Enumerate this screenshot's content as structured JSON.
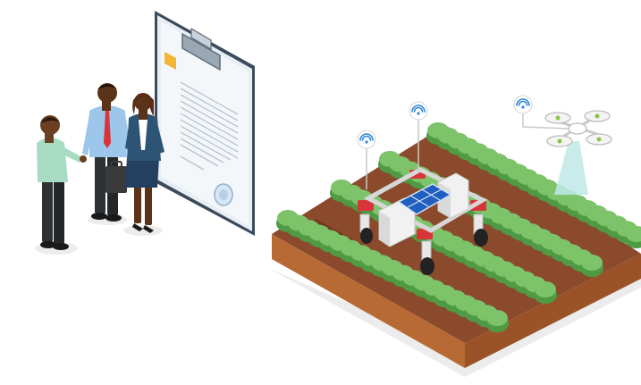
{
  "scene": {
    "people_count": 3,
    "crop_rows": 4,
    "wifi_signals": 3,
    "colors": {
      "background": "#ffffff",
      "paper": "#eef3f7",
      "clipboard": "#3b4a5c",
      "folder_tab": "#f2b632",
      "foliage": "#7cc36a",
      "foliage_dark": "#4f9a44",
      "soil": "#8a4a2b",
      "soil_side": "#b86a35",
      "robot_body": "#f1f1f1",
      "robot_red": "#d8343a",
      "solar_panel": "#1f5fbf",
      "signal_blue": "#2f86d6",
      "drone_beam": "#bfe9e6"
    },
    "icons": {
      "contract": "contract-icon",
      "wifi": "wifi-icon",
      "drone": "drone-icon",
      "robot": "farm-robot-icon",
      "seal": "seal-icon"
    }
  }
}
